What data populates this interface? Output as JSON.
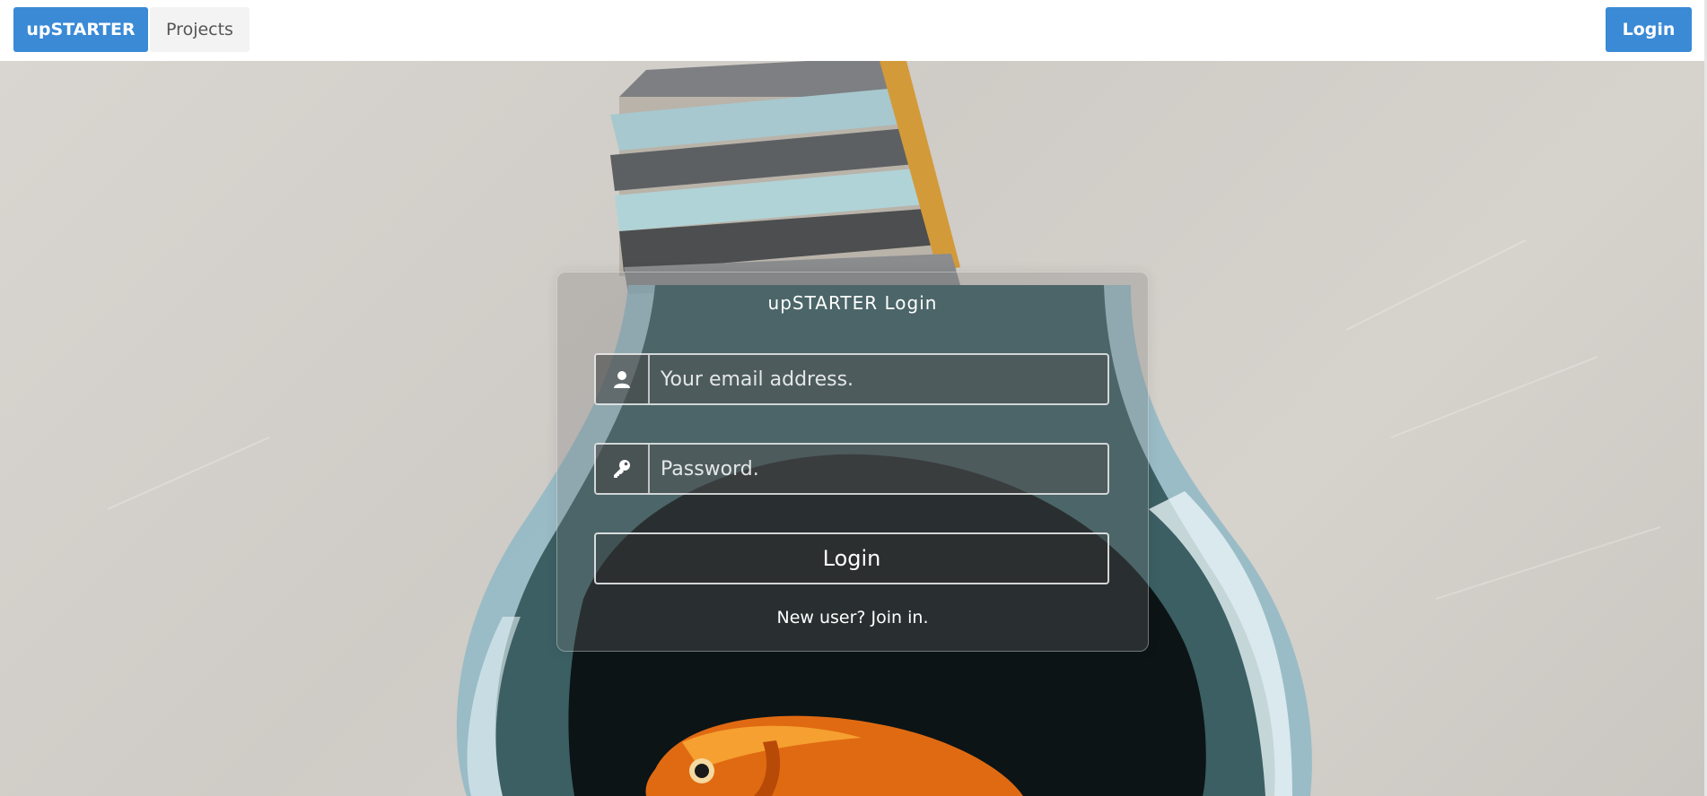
{
  "navbar": {
    "brand_label": "upSTARTER",
    "projects_label": "Projects",
    "login_label": "Login"
  },
  "login_panel": {
    "title": "upSTARTER Login",
    "email_placeholder": "Your email address.",
    "password_placeholder": "Password.",
    "submit_label": "Login",
    "register_link": "New user? Join in.",
    "email_icon": "user-icon",
    "password_icon": "key-icon"
  },
  "colors": {
    "primary": "#3a8ad6",
    "secondary_button": "#f3f3f3",
    "panel_text": "#ffffff"
  }
}
